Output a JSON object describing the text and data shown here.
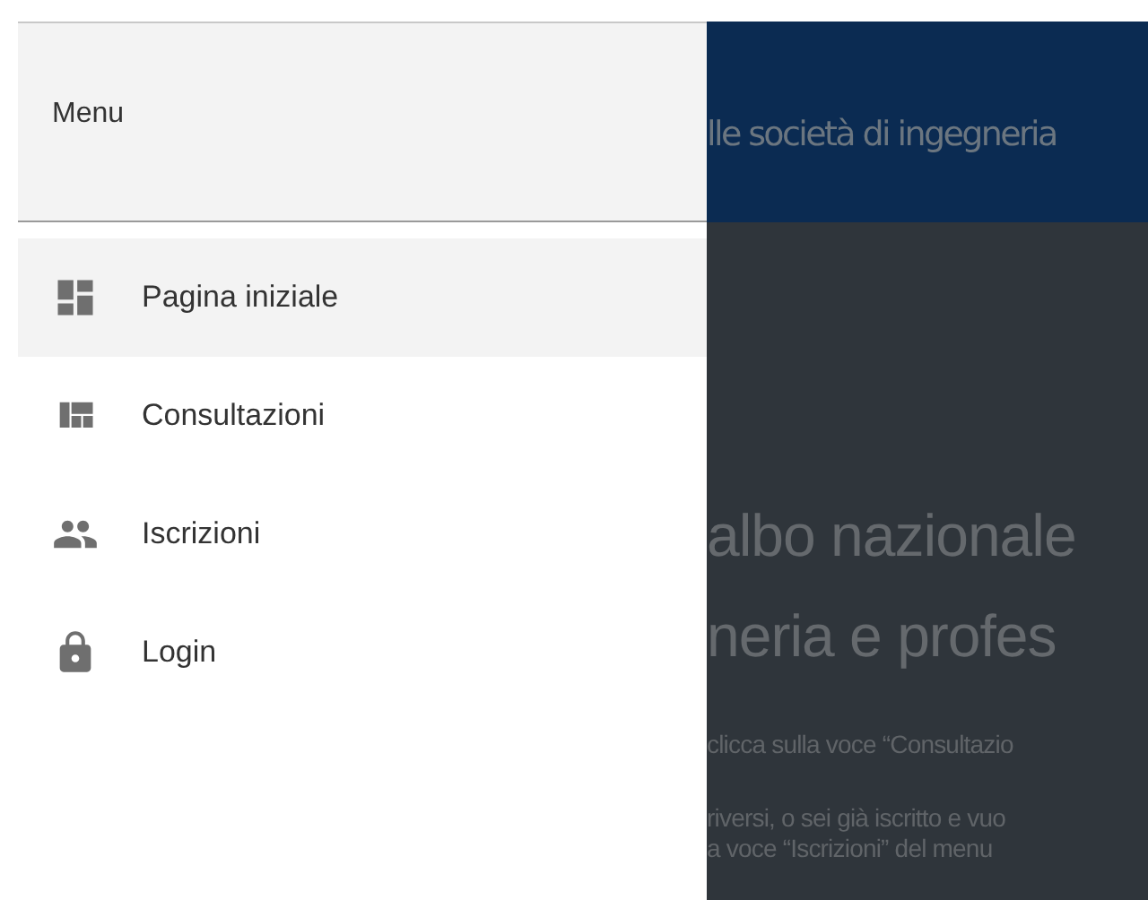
{
  "drawer": {
    "title": "Menu",
    "items": [
      {
        "label": "Pagina iniziale",
        "selected": true
      },
      {
        "label": "Consultazioni",
        "selected": false
      },
      {
        "label": "Iscrizioni",
        "selected": false
      },
      {
        "label": "Login",
        "selected": false
      }
    ]
  },
  "background_page": {
    "header_text": "lle società di ingegneria",
    "heading_lines": [
      "albo nazionale",
      "neria e profes"
    ],
    "paragraph_lines": [
      "clicca sulla voce “Consultazio",
      "riversi, o sei già iscritto e vuo",
      "a voce “Iscrizioni” del menu"
    ]
  }
}
